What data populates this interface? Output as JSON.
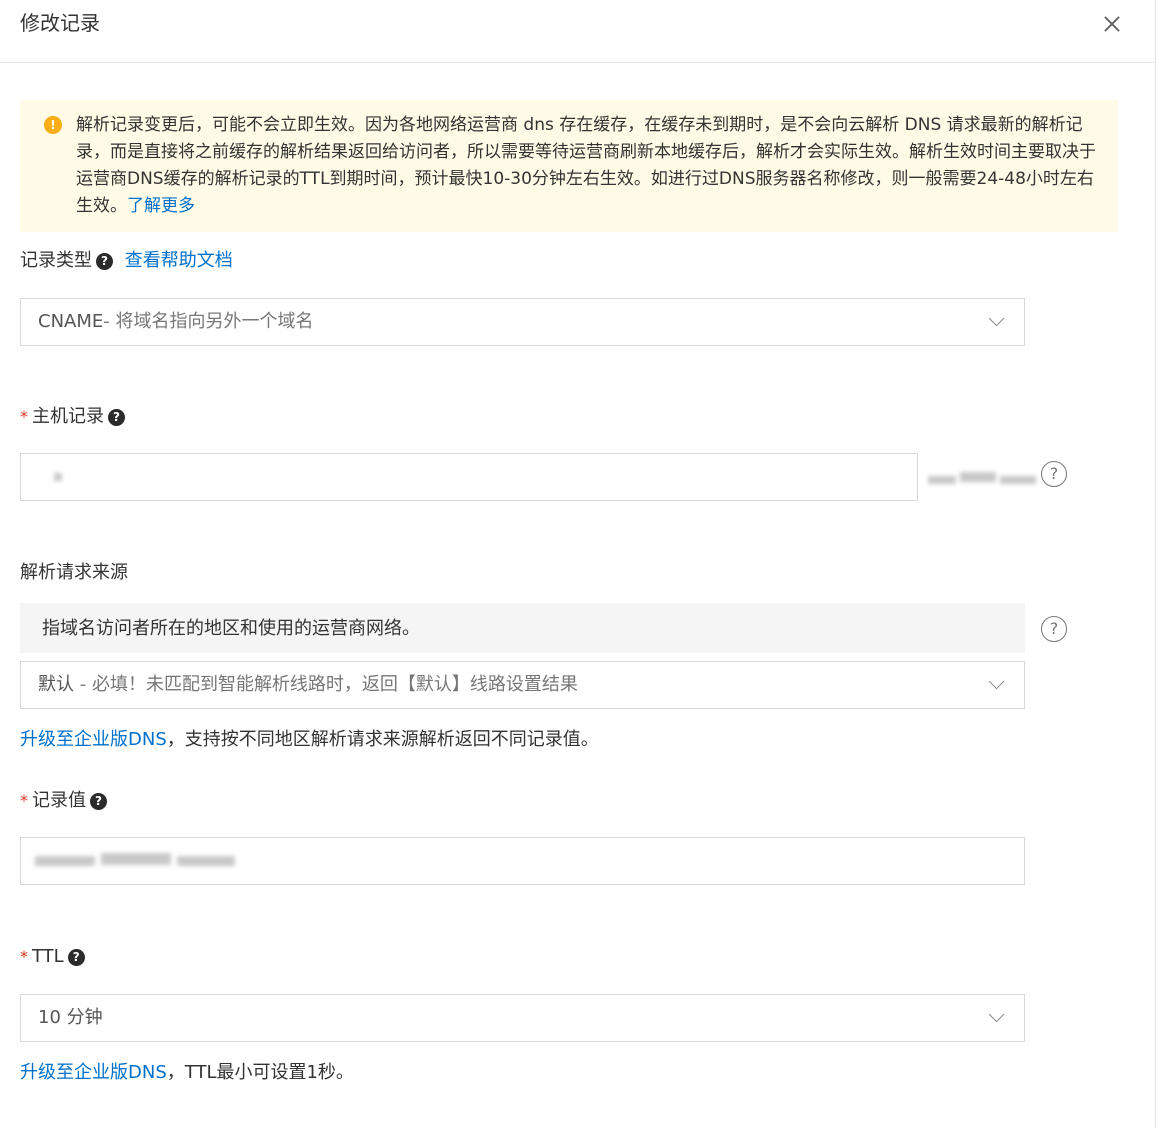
{
  "header": {
    "title": "修改记录"
  },
  "alert": {
    "text": "解析记录变更后，可能不会立即生效。因为各地网络运营商 dns 存在缓存，在缓存未到期时，是不会向云解析 DNS 请求最新的解析记录，而是直接将之前缓存的解析结果返回给访问者，所以需要等待运营商刷新本地缓存后，解析才会实际生效。解析生效时间主要取决于运营商DNS缓存的解析记录的TTL到期时间，预计最快10-30分钟左右生效。如进行过DNS服务器名称修改，则一般需要24-48小时左右生效。",
    "link": "了解更多"
  },
  "record_type": {
    "label": "记录类型",
    "help_link": "查看帮助文档",
    "value": "CNAME",
    "value_desc": "- 将域名指向另外一个域名"
  },
  "host_record": {
    "required_mark": "*",
    "label": "主机记录"
  },
  "request_source": {
    "label": "解析请求来源",
    "description": "指域名访问者所在的地区和使用的运营商网络。",
    "value": "默认",
    "value_desc": " - 必填！未匹配到智能解析线路时，返回【默认】线路设置结果",
    "upgrade_link": "升级至企业版DNS",
    "upgrade_text": "，支持按不同地区解析请求来源解析返回不同记录值。"
  },
  "record_value": {
    "required_mark": "*",
    "label": "记录值"
  },
  "ttl": {
    "required_mark": "*",
    "label": "TTL",
    "value": "10 分钟",
    "upgrade_link": "升级至企业版DNS",
    "upgrade_text": "，TTL最小可设置1秒。"
  },
  "icons": {
    "help": "?",
    "warning": "!"
  }
}
